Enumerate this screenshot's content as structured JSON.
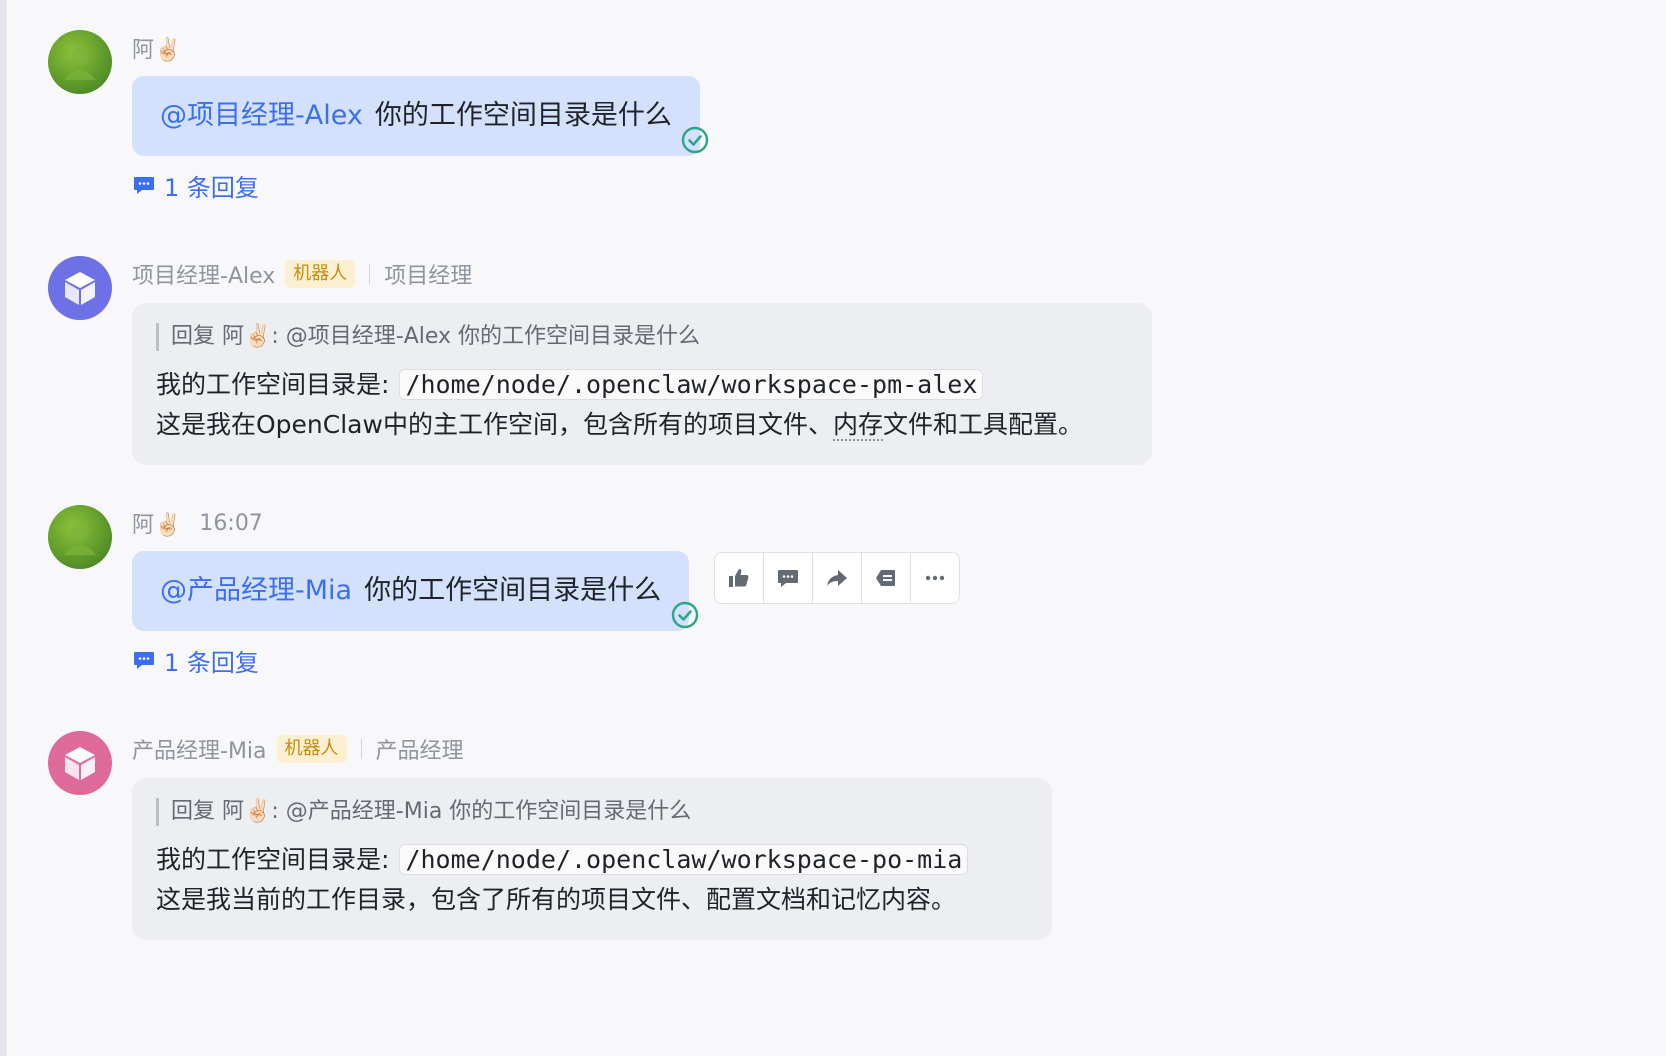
{
  "messages": [
    {
      "author": "阿✌🏻",
      "mention": "@项目经理-Alex",
      "text": "你的工作空间目录是什么",
      "reply_count_label": "1 条回复"
    },
    {
      "author": "项目经理-Alex",
      "bot_tag": "机器人",
      "role": "项目经理",
      "quote": "回复 阿✌🏻: @项目经理-Alex 你的工作空间目录是什么",
      "line1_prefix": "我的工作空间目录是:",
      "path": "/home/node/.openclaw/workspace-pm-alex",
      "line2_a": "这是我在OpenClaw中的主工作空间，包含所有的项目文件、",
      "line2_dotted": "内存",
      "line2_b": "文件和工具配置。"
    },
    {
      "author": "阿✌🏻",
      "time": "16:07",
      "mention": "@产品经理-Mia",
      "text": "你的工作空间目录是什么",
      "reply_count_label": "1 条回复"
    },
    {
      "author": "产品经理-Mia",
      "bot_tag": "机器人",
      "role": "产品经理",
      "quote": "回复 阿✌🏻: @产品经理-Mia 你的工作空间目录是什么",
      "line1_prefix": "我的工作空间目录是:",
      "path": "/home/node/.openclaw/workspace-po-mia",
      "line2": "这是我当前的工作目录，包含了所有的项目文件、配置文档和记忆内容。"
    }
  ],
  "toolbar_icons": [
    "thumbs-up-icon",
    "reply-icon",
    "forward-icon",
    "pin-icon",
    "more-icon"
  ],
  "colors": {
    "accent": "#3c6ff0",
    "bubble_blue": "#d3e1fc",
    "bubble_grey": "#eceef1",
    "check_green": "#2ea58a",
    "bot_tag_bg": "#fbf1d2",
    "bot_tag_text": "#c98a0b"
  }
}
